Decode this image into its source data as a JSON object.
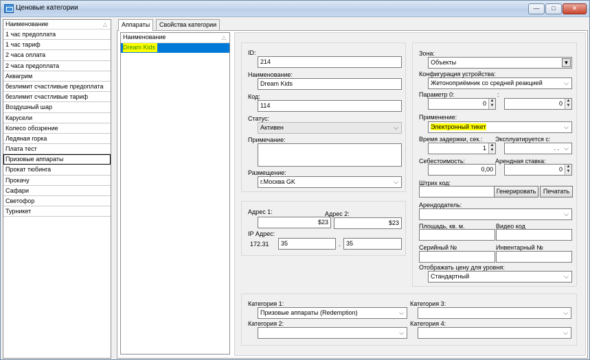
{
  "window": {
    "title": "Ценовые категории",
    "min_glyph": "—",
    "max_glyph": "□",
    "close_glyph": "✕"
  },
  "categories": {
    "header": "Наименование",
    "sort_glyph": "△",
    "items": [
      "1 час предоплата",
      "1 час тариф",
      "2 часа оплата",
      "2 часа предоплата",
      "Аквагрим",
      "безлимит счастливые предоплата",
      "безлимит счастливые тариф",
      "Воздушный шар",
      "Карусели",
      "Колесо обозрение",
      "Ледяная горка",
      "Плата тест",
      "Призовые аппараты",
      "Прокат тюбинга",
      "Прокачу",
      "Сафари",
      "Светофор",
      "Турникет"
    ],
    "selected_index": 12
  },
  "tabs": {
    "devices": "Аппараты",
    "properties": "Свойства категории"
  },
  "devices": {
    "header": "Наименование",
    "sort_glyph": "△",
    "items": [
      "Dream Kids"
    ]
  },
  "form": {
    "id_label": "ID:",
    "id_value": "214",
    "name_label": "Наименование:",
    "name_value": "Dream Kids",
    "code_label": "Код:",
    "code_value": "114",
    "status_label": "Статус:",
    "status_value": "Активен",
    "note_label": "Примечание:",
    "note_value": "",
    "placement_label": "Размещение:",
    "placement_value": "г.Москва GK",
    "address1_label": "Адрес 1:",
    "address1_value": "$23",
    "address2_label": "Адрес 2:",
    "address2_value": "$23",
    "ip_label": "IP Адрес:",
    "ip_prefix": "172.31",
    "ip_part3": "35",
    "ip_sep": ".",
    "ip_part4": "35",
    "zone_label": "Зона:",
    "zone_value": "Объекты",
    "config_label": "Конфигурация устройства:",
    "config_value": "Жетоноприёмник со средней реакцией",
    "param0_label": "Параметр 0:",
    "param_colon": ":",
    "param0_value": "0",
    "param1_value": "0",
    "usage_label": "Применение:",
    "usage_value": "Электронный тикет",
    "delay_label": "Время задержки, сек.:",
    "delay_value": "1",
    "exploited_label": "Эксплуатируется с:",
    "exploited_value": ". .",
    "cost_label": "Себестоимость:",
    "cost_value": "0,00",
    "rent_label": "Арендная ставка:",
    "rent_value": "0",
    "barcode_label": "Штрих код:",
    "barcode_value": "",
    "generate_button": "Генерировать",
    "print_button": "Печатать",
    "lessor_label": "Арендодатель:",
    "lessor_value": "",
    "area_label": "Площадь, кв. м.",
    "area_value": "",
    "video_label": "Видео код",
    "video_value": "",
    "serial_label": "Серийный №",
    "serial_value": "",
    "inventory_label": "Инвентарный №",
    "inventory_value": "",
    "price_level_label": "Отображать цену для уровня:",
    "price_level_value": "Стандартный",
    "cat1_label": "Категория 1:",
    "cat1_value": "Призовые аппараты (Redemption)",
    "cat2_label": "Категория 2:",
    "cat2_value": "",
    "cat3_label": "Категория 3:",
    "cat3_value": "",
    "cat4_label": "Категория 4:",
    "cat4_value": ""
  },
  "icons": {
    "combo_arrow": "⌵",
    "drop_arrow": "▼",
    "spin_up": "▲",
    "spin_down": "▼"
  },
  "colors": {
    "selection": "#0078d7",
    "highlight": "#ffff00"
  }
}
